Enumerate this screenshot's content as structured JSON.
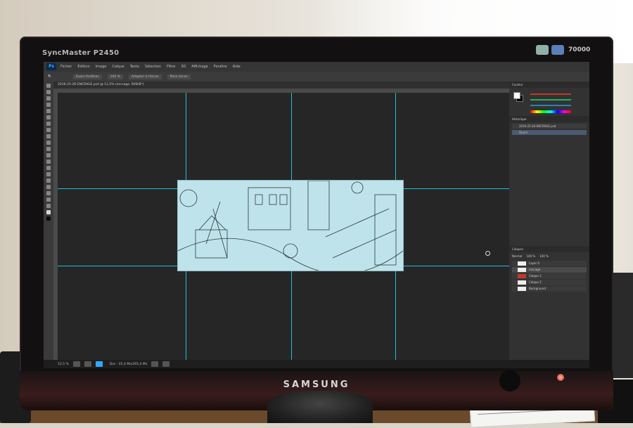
{
  "monitor": {
    "model_label": "SyncMaster P2450",
    "brand_label": "SAMSUNG",
    "badge_label": "70000"
  },
  "photoshop": {
    "app_badge": "Ps",
    "menu": [
      "Fichier",
      "Edition",
      "Image",
      "Calque",
      "Texte",
      "Sélection",
      "Filtre",
      "3D",
      "Affichage",
      "Fenêtre",
      "Aide"
    ],
    "options": {
      "zoom_windows": "Zoom fenêtres",
      "percent": "100 %",
      "fit_screen": "Adapter à l'écran",
      "fill_screen": "Plein écran"
    },
    "document_tab": "2016-25-26-ENCRAGE.psd @ 12,5% (encrage, RVB/8*)",
    "panels": {
      "color_tab": "Couleur",
      "history_tab": "Historique",
      "history_items": [
        "2016-25-26-ENCRAGE.psd",
        "Ouvrir"
      ],
      "layers_tab": "Calques",
      "layers": [
        {
          "name": "Layer 0",
          "thumb": "white"
        },
        {
          "name": "encrage",
          "thumb": "white",
          "selected": true
        },
        {
          "name": "Calque 1",
          "thumb": "red"
        },
        {
          "name": "Calque 2",
          "thumb": "white"
        },
        {
          "name": "Background",
          "thumb": "white"
        }
      ],
      "blend_mode": "Normal",
      "opacity": "100 %",
      "fill": "100 %"
    },
    "status_zoom": "12,5 %",
    "status_doc": "Doc : 45,4 Mo/265,4 Mo"
  }
}
